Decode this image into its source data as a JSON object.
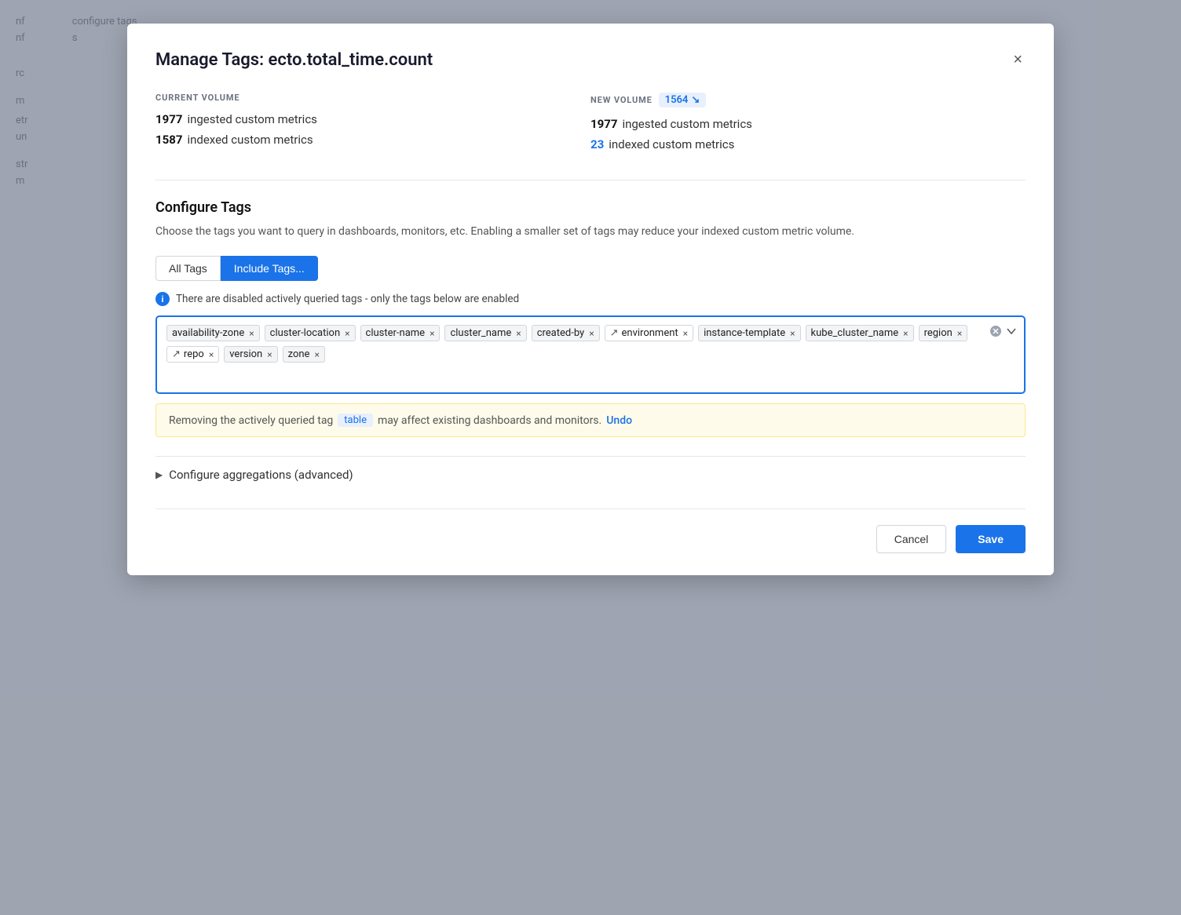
{
  "modal": {
    "title": "Manage Tags: ecto.total_time.count",
    "close_label": "×"
  },
  "volume": {
    "current_label": "CURRENT VOLUME",
    "new_label": "NEW VOLUME",
    "new_badge_value": "1564",
    "new_badge_icon": "↘",
    "current_ingested_num": "1977",
    "current_ingested_text": "ingested custom metrics",
    "current_indexed_num": "1587",
    "current_indexed_text": "indexed custom metrics",
    "new_ingested_num": "1977",
    "new_ingested_text": "ingested custom metrics",
    "new_indexed_num": "23",
    "new_indexed_text": "indexed custom metrics"
  },
  "configure_tags": {
    "title": "Configure Tags",
    "description": "Choose the tags you want to query in dashboards, monitors, etc. Enabling a smaller set of tags may reduce your indexed custom metric volume."
  },
  "tabs": [
    {
      "label": "All Tags",
      "active": false
    },
    {
      "label": "Include Tags...",
      "active": true
    }
  ],
  "info_banner": "There are disabled actively queried tags - only the tags below are enabled",
  "tags": [
    {
      "name": "availability-zone",
      "has_icon": false
    },
    {
      "name": "cluster-location",
      "has_icon": false
    },
    {
      "name": "cluster-name",
      "has_icon": false
    },
    {
      "name": "cluster_name",
      "has_icon": false
    },
    {
      "name": "created-by",
      "has_icon": false
    },
    {
      "name": "environment",
      "has_icon": true
    },
    {
      "name": "instance-template",
      "has_icon": false
    },
    {
      "name": "kube_cluster_name",
      "has_icon": false
    },
    {
      "name": "region",
      "has_icon": false
    },
    {
      "name": "repo",
      "has_icon": true
    },
    {
      "name": "version",
      "has_icon": false
    },
    {
      "name": "zone",
      "has_icon": false
    }
  ],
  "warning_banner": {
    "prefix": "Removing the actively queried tag",
    "tag": "table",
    "suffix": "may affect existing dashboards and monitors.",
    "undo_label": "Undo"
  },
  "configure_agg": {
    "label": "Configure aggregations (advanced)"
  },
  "footer": {
    "cancel_label": "Cancel",
    "save_label": "Save"
  }
}
